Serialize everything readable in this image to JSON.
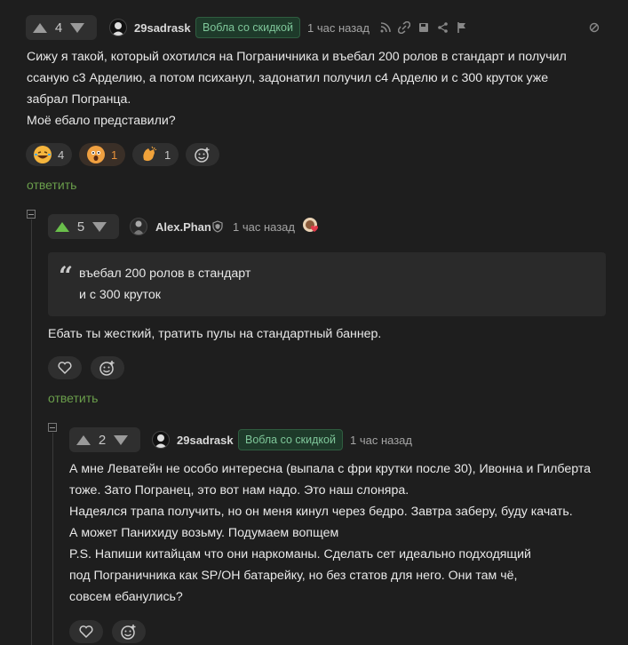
{
  "comment1": {
    "votes": "4",
    "username": "29sadrask",
    "badge": "Вобла со скидкой",
    "time": "1 час назад",
    "lines": [
      "Сижу я такой, который охотился на Пограничника и въебал 200 ролов в стандарт и получил",
      "ссаную с3 Арделию, а потом психанул, задонатил получил с4 Арделю и с 300 круток уже",
      "забрал Погранца.",
      "Моё ебало представили?"
    ],
    "reactions": [
      {
        "icon": "laughing-emoji-icon",
        "count": "4"
      },
      {
        "icon": "surprised-emoji-icon",
        "count": "1"
      },
      {
        "icon": "clapping-hands-icon",
        "count": "1"
      }
    ],
    "reply": "ответить",
    "tool_icons": [
      "rss-icon",
      "link-icon",
      "save-icon",
      "share-icon",
      "flag-icon",
      "hide-icon"
    ]
  },
  "comment2": {
    "votes": "5",
    "username": "Alex.Phan",
    "time": "1 час назад",
    "quote_lines": [
      "въебал 200 ролов в стандарт",
      "и с 300 круток"
    ],
    "lines": [
      "Ебать ты жесткий, тратить пулы на стандартный баннер."
    ],
    "reply": "ответить"
  },
  "comment3": {
    "votes": "2",
    "username": "29sadrask",
    "badge": "Вобла со скидкой",
    "time": "1 час назад",
    "lines": [
      "А мне Леватейн не особо интересна (выпала с фри крутки после 30), Ивонна и Гилберта",
      "тоже. Зато Погранец, это вот нам надо. Это наш слоняра.",
      "Надеялся трапа получить, но он меня кинул через бедро. Завтра заберу, буду качать.",
      "А может Панихиду возьму. Подумаем вопщем",
      "P.S. Напиши китайцам что они наркоманы. Сделать сет идеально подходящий",
      "под Пограничника как SP/OH батарейку, но без статов для него. Они там чё,",
      "совсем ебанулись?"
    ]
  },
  "colors": {
    "accent_green": "#6abf4b",
    "reply_green": "#6a9e4b",
    "badge_text": "#7fc79a",
    "background": "#1e1e1e"
  }
}
